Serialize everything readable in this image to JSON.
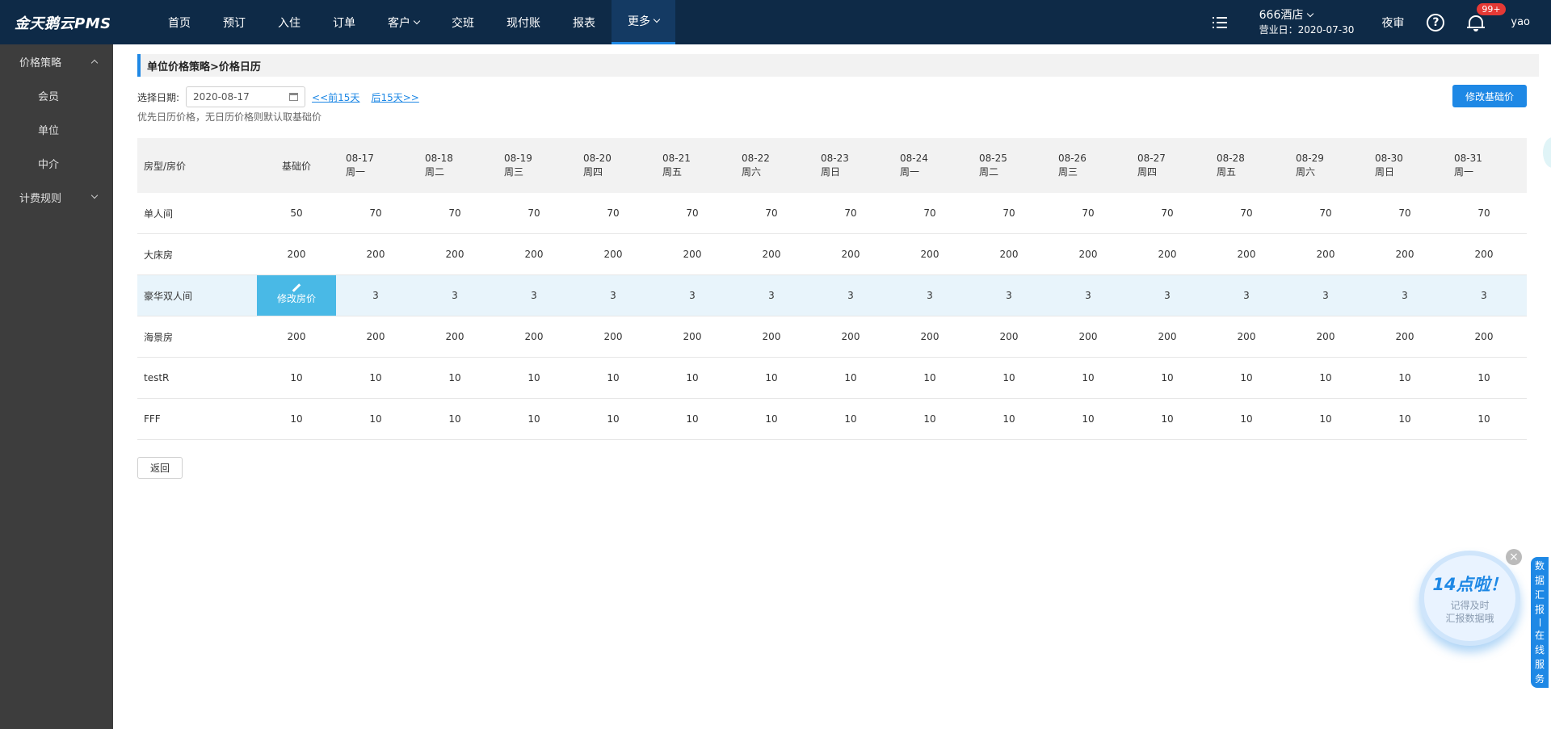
{
  "app": {
    "logo": "金天鹅云PMS"
  },
  "nav": [
    {
      "label": "首页"
    },
    {
      "label": "预订"
    },
    {
      "label": "入住"
    },
    {
      "label": "订单"
    },
    {
      "label": "客户",
      "dropdown": true
    },
    {
      "label": "交班"
    },
    {
      "label": "现付账"
    },
    {
      "label": "报表"
    },
    {
      "label": "更多",
      "dropdown": true,
      "active": true
    }
  ],
  "header_right": {
    "hotel_name": "666酒店",
    "business_date": "营业日：2020-07-30",
    "night_audit": "夜审",
    "help": "?",
    "notify_badge": "99+",
    "user": "yao"
  },
  "sidebar": {
    "group1": "价格策略",
    "items": [
      {
        "label": "会员"
      },
      {
        "label": "单位"
      },
      {
        "label": "中介"
      }
    ],
    "group2": "计费规则"
  },
  "page": {
    "breadcrumb": "单位价格策略>价格日历",
    "date_label": "选择日期:",
    "date_value": "2020-08-17",
    "prev_link": "<<前15天",
    "next_link": "后15天>>",
    "hint": "优先日历价格，无日历价格则默认取基础价",
    "modify_base_btn": "修改基础价",
    "back_btn": "返回"
  },
  "table": {
    "col_type": "房型/房价",
    "col_base": "基础价",
    "days": [
      {
        "date": "08-17",
        "week": "周一"
      },
      {
        "date": "08-18",
        "week": "周二"
      },
      {
        "date": "08-19",
        "week": "周三"
      },
      {
        "date": "08-20",
        "week": "周四"
      },
      {
        "date": "08-21",
        "week": "周五"
      },
      {
        "date": "08-22",
        "week": "周六"
      },
      {
        "date": "08-23",
        "week": "周日"
      },
      {
        "date": "08-24",
        "week": "周一"
      },
      {
        "date": "08-25",
        "week": "周二"
      },
      {
        "date": "08-26",
        "week": "周三"
      },
      {
        "date": "08-27",
        "week": "周四"
      },
      {
        "date": "08-28",
        "week": "周五"
      },
      {
        "date": "08-29",
        "week": "周六"
      },
      {
        "date": "08-30",
        "week": "周日"
      },
      {
        "date": "08-31",
        "week": "周一"
      }
    ],
    "edit_price_label": "修改房价",
    "rows": [
      {
        "type": "单人间",
        "base": "50",
        "prices": [
          "70",
          "70",
          "70",
          "70",
          "70",
          "70",
          "70",
          "70",
          "70",
          "70",
          "70",
          "70",
          "70",
          "70",
          "70"
        ]
      },
      {
        "type": "大床房",
        "base": "200",
        "prices": [
          "200",
          "200",
          "200",
          "200",
          "200",
          "200",
          "200",
          "200",
          "200",
          "200",
          "200",
          "200",
          "200",
          "200",
          "200"
        ]
      },
      {
        "type": "豪华双人间",
        "base": "",
        "highlight": true,
        "prices": [
          "3",
          "3",
          "3",
          "3",
          "3",
          "3",
          "3",
          "3",
          "3",
          "3",
          "3",
          "3",
          "3",
          "3",
          "3"
        ]
      },
      {
        "type": "海景房",
        "base": "200",
        "prices": [
          "200",
          "200",
          "200",
          "200",
          "200",
          "200",
          "200",
          "200",
          "200",
          "200",
          "200",
          "200",
          "200",
          "200",
          "200"
        ]
      },
      {
        "type": "testR",
        "base": "10",
        "prices": [
          "10",
          "10",
          "10",
          "10",
          "10",
          "10",
          "10",
          "10",
          "10",
          "10",
          "10",
          "10",
          "10",
          "10",
          "10"
        ]
      },
      {
        "type": "FFF",
        "base": "10",
        "prices": [
          "10",
          "10",
          "10",
          "10",
          "10",
          "10",
          "10",
          "10",
          "10",
          "10",
          "10",
          "10",
          "10",
          "10",
          "10"
        ]
      }
    ]
  },
  "widgets": {
    "promo_title": "14点啦！",
    "promo_line1": "记得及时",
    "promo_line2": "汇报数据哦",
    "side_tab_top": [
      "数",
      "据",
      "汇",
      "报"
    ],
    "side_tab_bottom": [
      "在",
      "线",
      "服",
      "务"
    ]
  },
  "colors": {
    "topbar": "#0e2a47",
    "accent": "#1e88e5",
    "sidebar": "#3d3d3d",
    "edit_cell": "#49b9e6"
  }
}
